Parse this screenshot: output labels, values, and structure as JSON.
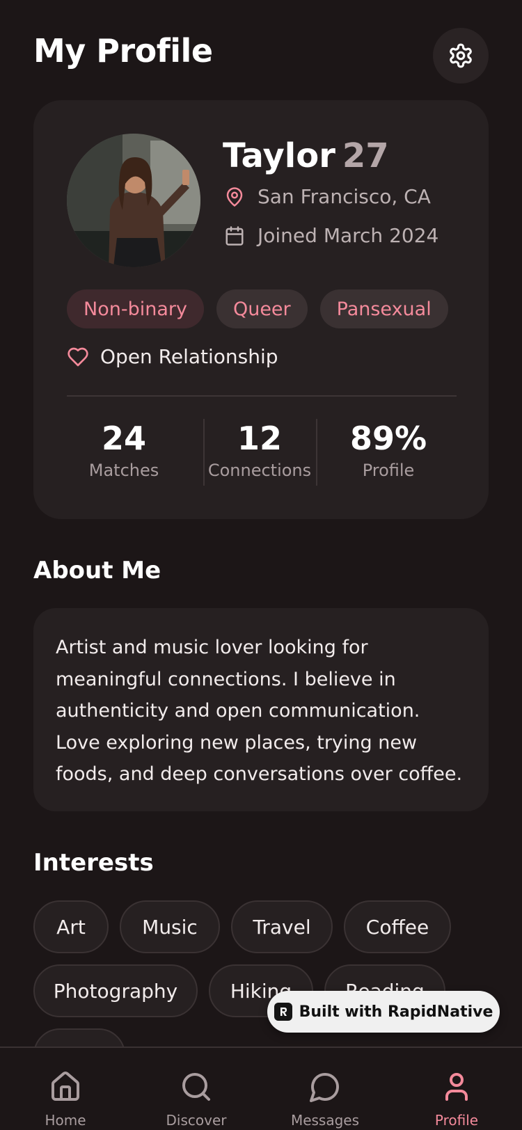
{
  "header": {
    "title": "My Profile",
    "settings_icon": "gear-icon"
  },
  "profile": {
    "name": "Taylor",
    "age": "27",
    "location": "San Francisco, CA",
    "joined": "Joined March 2024",
    "identities": [
      "Non-binary",
      "Queer",
      "Pansexual"
    ],
    "relationship": "Open Relationship",
    "stats": [
      {
        "value": "24",
        "label": "Matches"
      },
      {
        "value": "12",
        "label": "Connections"
      },
      {
        "value": "89%",
        "label": "Profile"
      }
    ]
  },
  "about": {
    "title": "About Me",
    "text": "Artist and music lover looking for meaningful connections. I believe in authenticity and open communication. Love exploring new places, trying new foods, and deep conversations over coffee."
  },
  "interests": {
    "title": "Interests",
    "items": [
      "Art",
      "Music",
      "Travel",
      "Coffee",
      "Photography",
      "Hiking",
      "Reading"
    ]
  },
  "badge": {
    "label": "Built with RapidNative"
  },
  "tabbar": {
    "items": [
      {
        "label": "Home",
        "icon": "home-icon"
      },
      {
        "label": "Discover",
        "icon": "search-icon"
      },
      {
        "label": "Messages",
        "icon": "chat-icon"
      },
      {
        "label": "Profile",
        "icon": "user-icon"
      }
    ],
    "active": "Profile"
  },
  "colors": {
    "background": "#1c1617",
    "card": "#262021",
    "accent": "#f48a9b",
    "muted": "#a99d9f"
  }
}
